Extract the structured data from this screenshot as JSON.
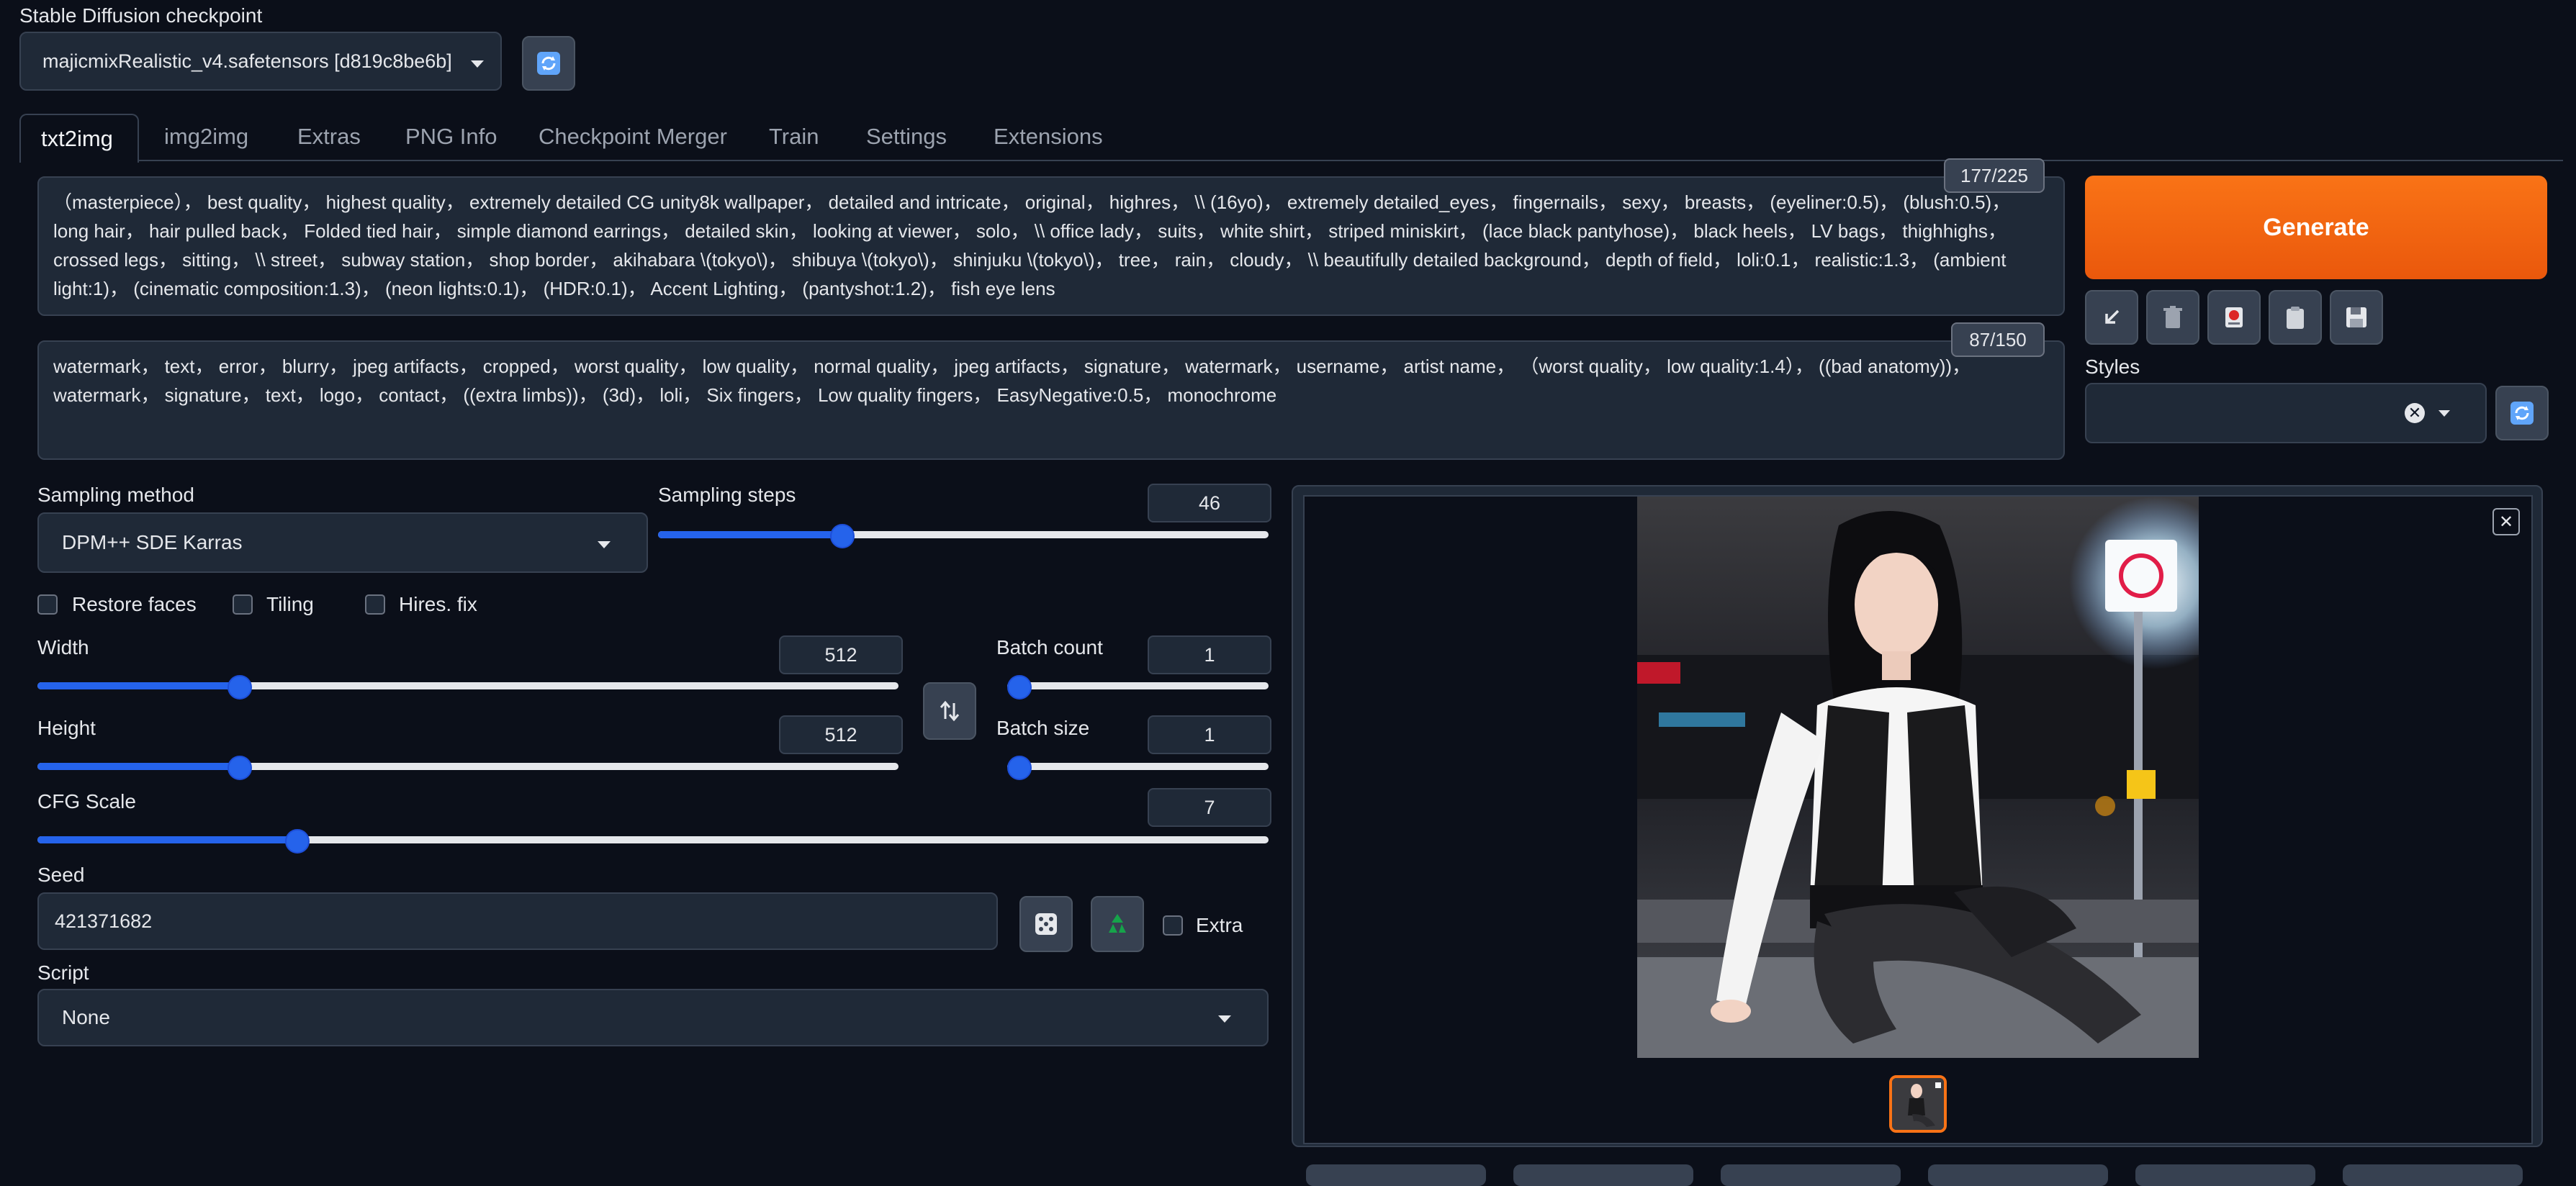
{
  "checkpoint": {
    "label": "Stable Diffusion checkpoint",
    "value": "majicmixRealistic_v4.safetensors [d819c8be6b]"
  },
  "tabs": [
    {
      "label": "txt2img",
      "active": true
    },
    {
      "label": "img2img"
    },
    {
      "label": "Extras"
    },
    {
      "label": "PNG Info"
    },
    {
      "label": "Checkpoint Merger"
    },
    {
      "label": "Train"
    },
    {
      "label": "Settings"
    },
    {
      "label": "Extensions"
    }
  ],
  "prompt": {
    "counter": "177/225",
    "text": "（masterpiece）， best quality， highest quality， extremely detailed CG unity8k wallpaper， detailed and intricate， original， highres， \\\\ (16yo)， extremely detailed_eyes， fingernails， sexy， breasts， (eyeliner:0.5)， (blush:0.5)， long hair， hair pulled back， Folded tied hair， simple diamond earrings， detailed skin， looking at viewer， solo， \\\\ office lady， suits， white shirt， striped miniskirt， (lace black pantyhose)， black heels， LV bags， thighhighs， crossed legs， sitting， \\\\ street， subway station， shop border， akihabara \\(tokyo\\)， shibuya \\(tokyo\\)， shinjuku \\(tokyo\\)， tree， rain， cloudy， \\\\ beautifully detailed background， depth of field， loli:0.1， realistic:1.3， (ambient light:1)， (cinematic composition:1.3)， (neon lights:0.1)， (HDR:0.1)， Accent Lighting， (pantyshot:1.2)， fish eye lens"
  },
  "negative_prompt": {
    "counter": "87/150",
    "text": "watermark， text， error， blurry， jpeg artifacts， cropped， worst quality， low quality， normal quality， jpeg artifacts， signature， watermark， username， artist name， （worst quality， low quality:1.4）， ((bad anatomy))， watermark， signature， text， logo， contact， ((extra limbs))， (3d)， loli， Six fingers， Low quality fingers， EasyNegative:0.5， monochrome"
  },
  "generate_label": "Generate",
  "styles_label": "Styles",
  "sampling_method": {
    "label": "Sampling method",
    "value": "DPM++ SDE Karras"
  },
  "sampling_steps": {
    "label": "Sampling steps",
    "value": "46",
    "fraction": 0.3
  },
  "checkboxes": {
    "restore_faces": "Restore faces",
    "tiling": "Tiling",
    "hires_fix": "Hires. fix",
    "extra": "Extra"
  },
  "width": {
    "label": "Width",
    "value": "512",
    "fraction": 0.233
  },
  "height": {
    "label": "Height",
    "value": "512",
    "fraction": 0.233
  },
  "batch_count": {
    "label": "Batch count",
    "value": "1",
    "fraction": 0.0
  },
  "batch_size": {
    "label": "Batch size",
    "value": "1",
    "fraction": 0.0
  },
  "cfg_scale": {
    "label": "CFG Scale",
    "value": "7",
    "fraction": 0.21
  },
  "seed": {
    "label": "Seed",
    "value": "421371682"
  },
  "script": {
    "label": "Script",
    "value": "None"
  },
  "colors": {
    "accent": "#2563eb",
    "generate": "#ea580c",
    "background": "#0b0f19",
    "panel": "#1f2937"
  }
}
